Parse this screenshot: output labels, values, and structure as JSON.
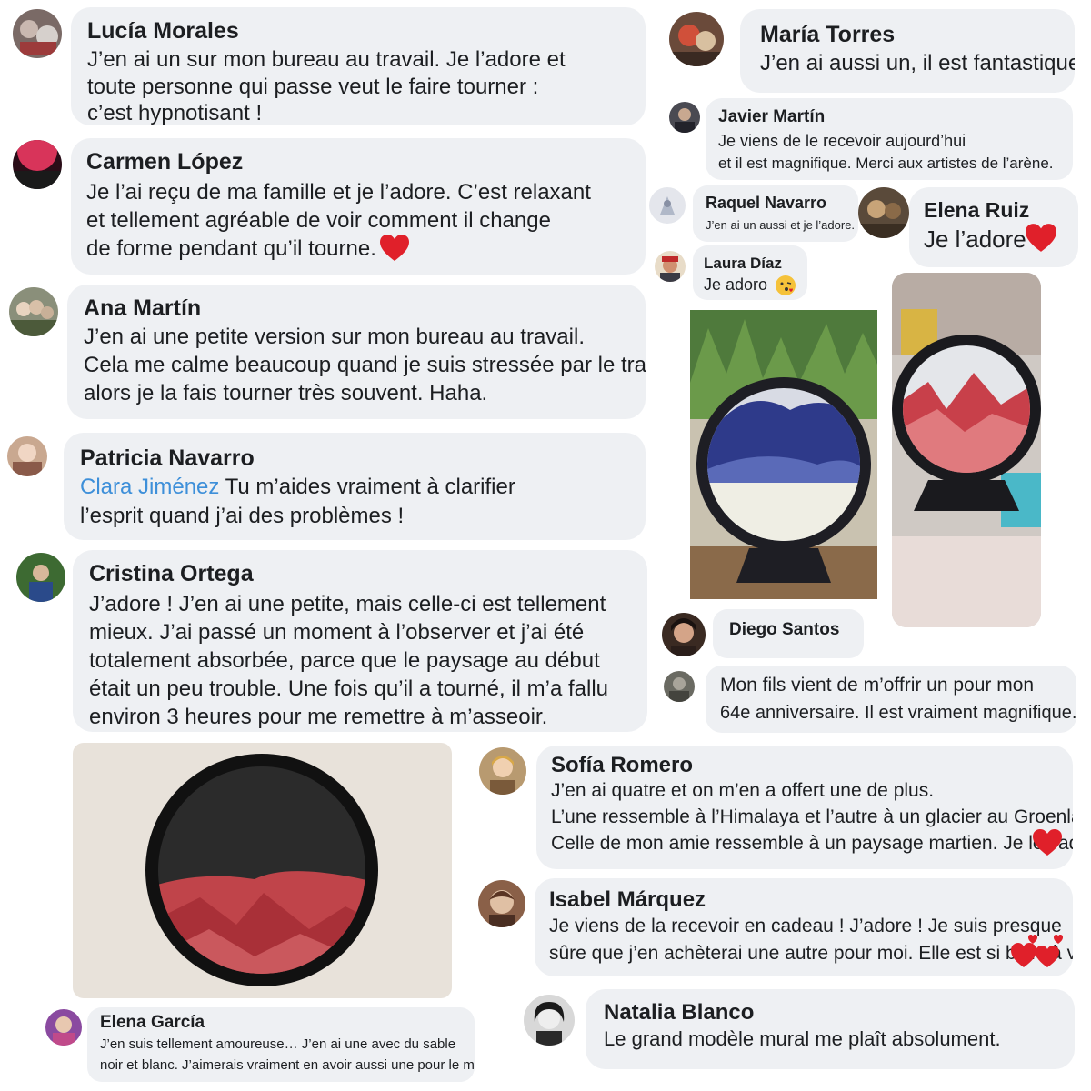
{
  "comments": {
    "lucia": {
      "name": "Lucía Morales",
      "lines": [
        "J’en ai un sur mon bureau au travail. Je l’adore et",
        "toute personne qui passe veut le faire tourner :",
        "c’est hypnotisant !"
      ]
    },
    "carmen": {
      "name": "Carmen López",
      "lines": [
        "Je l’ai reçu de ma famille et je l’adore. C’est relaxant",
        "et tellement agréable de voir comment il change",
        "de forme pendant qu’il tourne."
      ]
    },
    "ana": {
      "name": "Ana Martín",
      "lines": [
        "J’en ai une petite version sur mon bureau au travail.",
        "Cela me calme beaucoup quand je suis stressée par le travail,",
        "alors je la fais tourner très souvent. Haha."
      ]
    },
    "patricia": {
      "name": "Patricia Navarro",
      "mention": "Clara Jiménez",
      "lines": [
        "Tu m’aides vraiment à clarifier",
        "l’esprit quand j’ai des problèmes !"
      ]
    },
    "cristina": {
      "name": "Cristina Ortega",
      "lines": [
        "J’adore ! J’en ai une petite, mais celle-ci est tellement",
        "mieux. J’ai passé un moment à l’observer et j’ai été",
        "totalement absorbée, parce que le paysage au début",
        "était un peu trouble. Une fois qu’il a tourné, il m’a fallu",
        "environ 3 heures pour me remettre à m’asseoir."
      ]
    },
    "elena_garcia": {
      "name": "Elena García",
      "lines": [
        "J’en suis tellement amoureuse… J’en ai une avec du sable",
        "noir et blanc. J’aimerais vraiment en avoir aussi une pour le mur."
      ]
    },
    "maria": {
      "name": "María Torres",
      "lines": [
        "J’en ai aussi un, il est fantastique."
      ]
    },
    "javier": {
      "name": "Javier Martín",
      "lines": [
        "Je viens de le recevoir aujourd’hui",
        "et il est magnifique. Merci aux artistes de l’arène."
      ]
    },
    "raquel": {
      "name": "Raquel Navarro",
      "lines": [
        "J’en ai un aussi et je l’adore."
      ]
    },
    "elena_ruiz": {
      "name": "Elena Ruiz",
      "lines": [
        "Je l’adore"
      ]
    },
    "laura": {
      "name": "Laura Díaz",
      "lines": [
        "Je adoro"
      ]
    },
    "diego": {
      "name": "Diego Santos",
      "lines": []
    },
    "anon": {
      "lines": [
        "Mon fils vient de m’offrir un pour mon",
        "64e anniversaire. Il est vraiment magnifique."
      ]
    },
    "sofia": {
      "name": "Sofía Romero",
      "lines": [
        "J’en ai quatre et on m’en a offert une de plus.",
        "L’une ressemble à l’Himalaya et l’autre à un glacier au Groenland.",
        "Celle de mon amie ressemble à un paysage martien. Je les adore."
      ]
    },
    "isabel": {
      "name": "Isabel Márquez",
      "lines": [
        "Je viens de la recevoir en cadeau ! J’adore ! Je suis presque",
        "sûre que j’en achèterai une autre pour moi. Elle est si belle à voir."
      ]
    },
    "natalia": {
      "name": "Natalia Blanco",
      "lines": [
        "Le grand modèle mural me plaît absolument."
      ]
    }
  },
  "icons": {
    "heart": "red-heart-icon",
    "kiss": "kissing-face-icon",
    "hearts": "two-hearts-icon"
  },
  "colors": {
    "bubble": "#eef0f3",
    "mention": "#3d8fd9",
    "heart": "#e0202a"
  }
}
